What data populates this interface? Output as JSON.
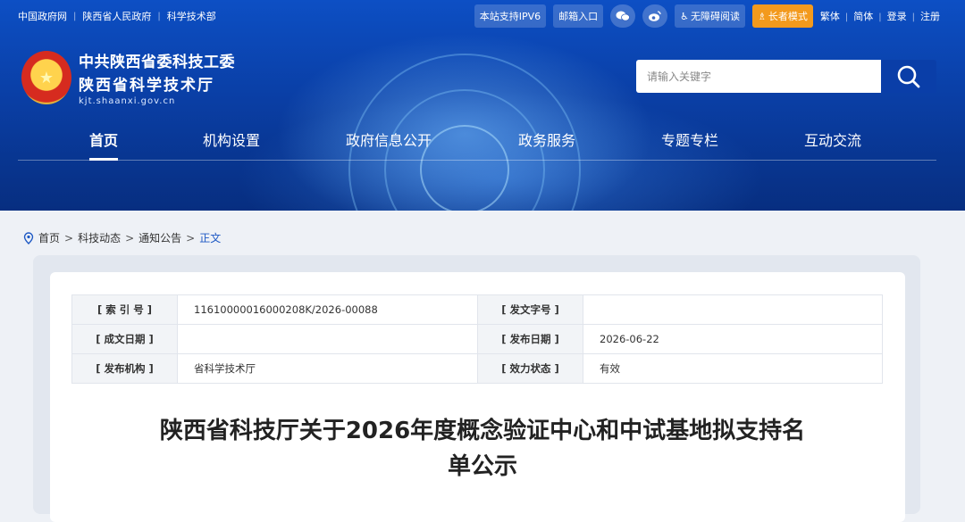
{
  "topbar": {
    "links": [
      "中国政府网",
      "陕西省人民政府",
      "科学技术部"
    ],
    "ipv6": "本站支持IPV6",
    "mail": "邮箱入口",
    "accessible": "无障碍阅读",
    "elder": "长者模式",
    "traditional": "繁体",
    "simplified": "简体",
    "login": "登录",
    "register": "注册"
  },
  "logo": {
    "line1": "中共陕西省委科技工委",
    "line2": "陕西省科学技术厅",
    "domain": "kjt.shaanxi.gov.cn"
  },
  "search": {
    "placeholder": "请输入关键字"
  },
  "nav": [
    "首页",
    "机构设置",
    "政府信息公开",
    "政务服务",
    "专题专栏",
    "互动交流"
  ],
  "breadcrumb": [
    "首页",
    "科技动态",
    "通知公告",
    "正文"
  ],
  "meta": {
    "index_label": "[ 索 引 号 ]",
    "index_value": "11610000016000208K/2026-00088",
    "docno_label": "[ 发文字号 ]",
    "docno_value": "",
    "created_label": "[ 成文日期 ]",
    "created_value": "",
    "published_label": "[ 发布日期 ]",
    "published_value": "2026-06-22",
    "org_label": "[ 发布机构 ]",
    "org_value": "省科学技术厅",
    "status_label": "[ 效力状态 ]",
    "status_value": "有效"
  },
  "article": {
    "title_line1": "陕西省科技厅关于2026年度概念验证中心和中试基地拟支持名",
    "title_line2": "单公示"
  }
}
